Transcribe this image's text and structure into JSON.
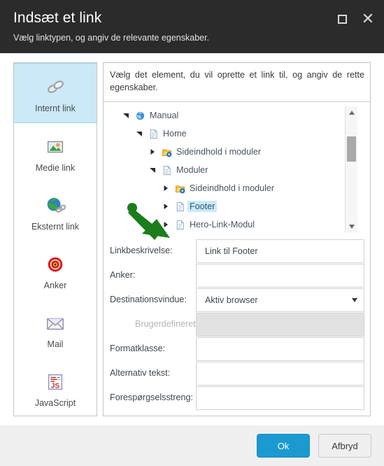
{
  "window": {
    "title": "Indsæt et link",
    "subtitle": "Vælg linktypen, og angiv de relevante egenskaber.",
    "maximize_icon": "maximize-square-icon",
    "close_icon": "close-x-icon"
  },
  "sidebar": {
    "items": [
      {
        "label": "Internt link",
        "icon": "chain-link-icon",
        "selected": true
      },
      {
        "label": "Medie link",
        "icon": "image-media-icon",
        "selected": false
      },
      {
        "label": "Eksternt link",
        "icon": "globe-link-icon",
        "selected": false
      },
      {
        "label": "Anker",
        "icon": "anchor-target-icon",
        "selected": false
      },
      {
        "label": "Mail",
        "icon": "envelope-mail-icon",
        "selected": false
      },
      {
        "label": "JavaScript",
        "icon": "javascript-js-icon",
        "selected": false
      }
    ]
  },
  "main": {
    "instruction": "Vælg det element, du vil oprette et link til, og angiv de rette egenskaber.",
    "tree": [
      {
        "label": "Manual",
        "icon": "globe-site-icon",
        "indent": 0,
        "state": "expanded",
        "selected": false
      },
      {
        "label": "Home",
        "icon": "page-document-icon",
        "indent": 1,
        "state": "expanded",
        "selected": false
      },
      {
        "label": "Sideindhold i moduler",
        "icon": "folder-module-icon",
        "indent": 2,
        "state": "collapsed",
        "selected": false
      },
      {
        "label": "Moduler",
        "icon": "page-document-icon",
        "indent": 2,
        "state": "expanded",
        "selected": false
      },
      {
        "label": "Sideindhold i moduler",
        "icon": "folder-module-icon",
        "indent": 3,
        "state": "collapsed",
        "selected": false
      },
      {
        "label": "Footer",
        "icon": "page-document-icon",
        "indent": 3,
        "state": "collapsed",
        "selected": true
      },
      {
        "label": "Hero-Link-Modul",
        "icon": "page-document-icon",
        "indent": 3,
        "state": "collapsed",
        "selected": false
      }
    ],
    "scrollbar": {
      "up_icon": "scroll-up-arrow-icon",
      "down_icon": "scroll-down-arrow-icon"
    },
    "form": [
      {
        "label": "Linkbeskrivelse:",
        "type": "text",
        "value": "Link til Footer",
        "disabled": false
      },
      {
        "label": "Anker:",
        "type": "text",
        "value": "",
        "disabled": false
      },
      {
        "label": "Destinationsvindue:",
        "type": "select",
        "value": "Aktiv browser",
        "disabled": false
      },
      {
        "label": "Brugerdefineret:",
        "type": "text",
        "value": "",
        "disabled": true
      },
      {
        "label": "Formatklasse:",
        "type": "text",
        "value": "",
        "disabled": false
      },
      {
        "label": "Alternativ tekst:",
        "type": "text",
        "value": "",
        "disabled": false
      },
      {
        "label": "Forespørgselsstreng:",
        "type": "text",
        "value": "",
        "disabled": false
      }
    ]
  },
  "annotation": {
    "shape": "green-arrow-icon",
    "color": "#1b7d1b"
  },
  "footer": {
    "ok_label": "Ok",
    "cancel_label": "Afbryd",
    "ok_color": "#1b9ad1"
  }
}
